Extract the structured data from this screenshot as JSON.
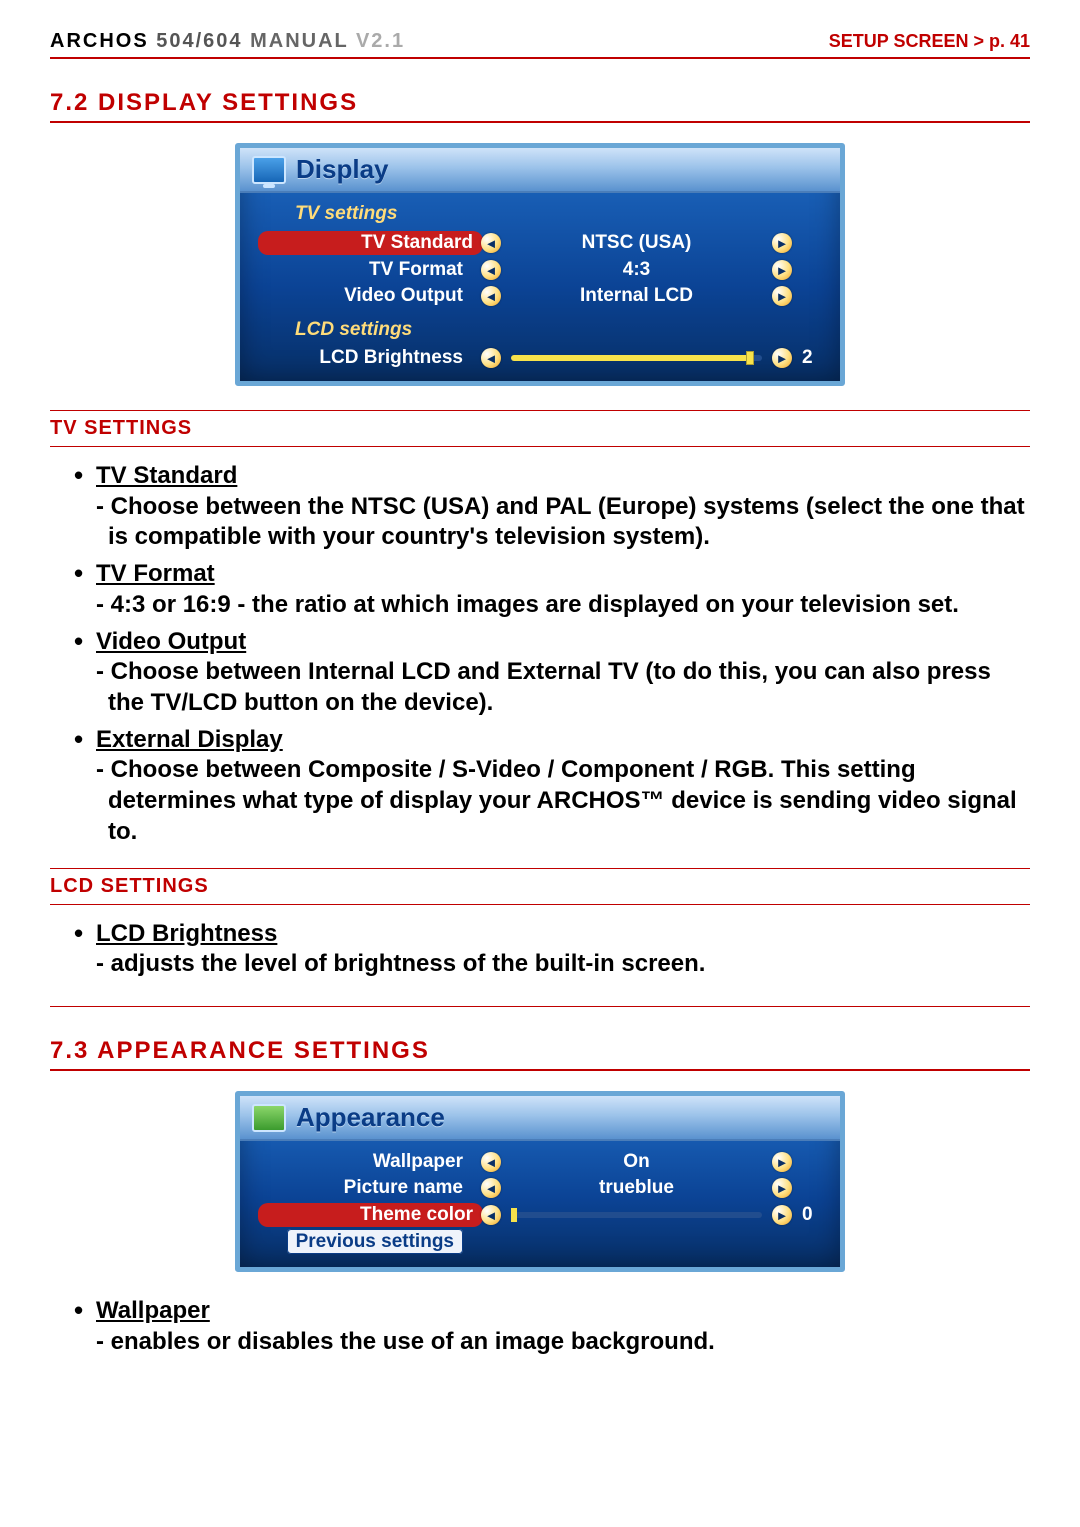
{
  "header": {
    "brand": "ARCHOS",
    "model": "504/604",
    "manual": "MANUAL",
    "version": "V2.1",
    "breadcrumb": "SETUP SCREEN  >  p. 41"
  },
  "section72": {
    "title": "7.2  DISPLAY SETTINGS"
  },
  "display_shot": {
    "title": "Display",
    "group_tv": "TV settings",
    "rows": [
      {
        "label": "TV Standard",
        "value": "NTSC (USA)",
        "selected": true
      },
      {
        "label": "TV Format",
        "value": "4:3",
        "selected": false
      },
      {
        "label": "Video Output",
        "value": "Internal LCD",
        "selected": false
      }
    ],
    "group_lcd": "LCD settings",
    "lcd_row": {
      "label": "LCD Brightness",
      "num": "2"
    }
  },
  "tv_settings_header": "TV Settings",
  "tv_settings_items": [
    {
      "title": "TV Standard",
      "desc": "Choose between the NTSC (USA) and PAL (Europe) systems (select the one that is compatible with your country's television system)."
    },
    {
      "title": "TV Format",
      "desc": "4:3 or 16:9 - the ratio at which images are displayed on your television set."
    },
    {
      "title": "Video Output",
      "desc": "Choose between Internal LCD and External TV (to do this, you can also press the TV/LCD button on the device)."
    },
    {
      "title": "External Display",
      "desc": "Choose between Composite / S-Video / Component / RGB. This setting determines what type of display your ARCHOS™ device is sending video signal to."
    }
  ],
  "lcd_settings_header": "LCD Settings",
  "lcd_settings_items": [
    {
      "title": "LCD Brightness",
      "desc": "adjusts the level of brightness of the built-in screen."
    }
  ],
  "section73": {
    "title": "7.3  APPEARANCE SETTINGS"
  },
  "appearance_shot": {
    "title": "Appearance",
    "rows": [
      {
        "label": "Wallpaper",
        "value": "On"
      },
      {
        "label": "Picture name",
        "value": "trueblue"
      },
      {
        "label": "Theme color",
        "slider": true,
        "num": "0",
        "selected": true
      },
      {
        "label": "Previous settings",
        "boxed": true
      }
    ]
  },
  "appearance_items": [
    {
      "title": "Wallpaper",
      "desc": "enables or disables the use of an image background."
    }
  ],
  "arrows": {
    "left": "◄",
    "right": "►"
  }
}
